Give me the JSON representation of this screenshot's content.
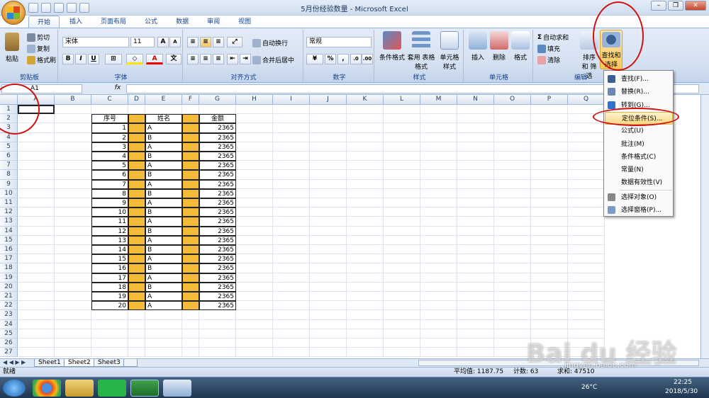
{
  "window": {
    "title": "5月份经验数量 - Microsoft Excel"
  },
  "tabs": [
    "开始",
    "插入",
    "页面布局",
    "公式",
    "数据",
    "审阅",
    "视图"
  ],
  "ribbon": {
    "clipboard": {
      "label": "剪贴板",
      "paste": "粘贴",
      "cut": "剪切",
      "copy": "复制",
      "format_painter": "格式刷"
    },
    "font": {
      "label": "字体",
      "font_name": "宋体",
      "font_size": "11",
      "bold": "B",
      "italic": "I",
      "underline": "U",
      "grow": "A",
      "shrink": "A"
    },
    "alignment": {
      "label": "对齐方式",
      "wrap": "自动换行",
      "merge": "合并后居中"
    },
    "number": {
      "label": "数字",
      "format": "常规",
      "percent": "%",
      "comma": ","
    },
    "styles": {
      "label": "样式",
      "cond_format": "条件格式",
      "table_format": "套用 表格格式",
      "cell_styles": "单元格 样式"
    },
    "cells": {
      "label": "单元格",
      "insert": "插入",
      "delete": "删除",
      "format": "格式"
    },
    "editing": {
      "label": "编辑",
      "autosum": "自动求和",
      "fill": "填充",
      "clear": "清除",
      "sort": "排序和 筛选",
      "find": "查找和 选择"
    }
  },
  "formula_bar": {
    "name_box": "A1",
    "fx": "fx",
    "value": ""
  },
  "columns": [
    "A",
    "B",
    "C",
    "D",
    "E",
    "F",
    "G",
    "H",
    "I",
    "J",
    "K",
    "L",
    "M",
    "N",
    "O",
    "P",
    "Q"
  ],
  "table": {
    "headers": {
      "seq": "序号",
      "name": "姓名",
      "amount": "金额"
    },
    "rows": [
      {
        "seq": "1",
        "name": "A",
        "amount": "2365"
      },
      {
        "seq": "2",
        "name": "B",
        "amount": "2365"
      },
      {
        "seq": "3",
        "name": "A",
        "amount": "2365"
      },
      {
        "seq": "4",
        "name": "B",
        "amount": "2365"
      },
      {
        "seq": "5",
        "name": "A",
        "amount": "2365"
      },
      {
        "seq": "6",
        "name": "B",
        "amount": "2365"
      },
      {
        "seq": "7",
        "name": "A",
        "amount": "2365"
      },
      {
        "seq": "8",
        "name": "B",
        "amount": "2365"
      },
      {
        "seq": "9",
        "name": "A",
        "amount": "2365"
      },
      {
        "seq": "10",
        "name": "B",
        "amount": "2365"
      },
      {
        "seq": "11",
        "name": "A",
        "amount": "2365"
      },
      {
        "seq": "12",
        "name": "B",
        "amount": "2365"
      },
      {
        "seq": "13",
        "name": "A",
        "amount": "2365"
      },
      {
        "seq": "14",
        "name": "B",
        "amount": "2365"
      },
      {
        "seq": "15",
        "name": "A",
        "amount": "2365"
      },
      {
        "seq": "16",
        "name": "B",
        "amount": "2365"
      },
      {
        "seq": "17",
        "name": "A",
        "amount": "2365"
      },
      {
        "seq": "18",
        "name": "B",
        "amount": "2365"
      },
      {
        "seq": "19",
        "name": "A",
        "amount": "2365"
      },
      {
        "seq": "20",
        "name": "A",
        "amount": "2365"
      }
    ]
  },
  "menu": {
    "items": [
      "查找(F)...",
      "替换(R)...",
      "转到(G)...",
      "定位条件(S)...",
      "公式(U)",
      "批注(M)",
      "条件格式(C)",
      "常量(N)",
      "数据有效性(V)",
      "选择对象(O)",
      "选择窗格(P)..."
    ],
    "highlighted_index": 3
  },
  "sheets": [
    "Sheet1",
    "Sheet2",
    "Sheet3"
  ],
  "active_sheet": "Sheet2",
  "status": {
    "mode": "就绪",
    "average": "平均值: 1187.75",
    "count": "计数: 63",
    "sum": "求和: 47510"
  },
  "taskbar": {
    "time": "22:25",
    "date": "2018/5/30",
    "temp": "26°C"
  },
  "watermark": {
    "text": "Bai du 经验",
    "url": "jingyan.baidu.com"
  },
  "colors": {
    "accent": "#f3bb38",
    "annotation": "#d01010",
    "ribbon": "#d3e0f1"
  }
}
